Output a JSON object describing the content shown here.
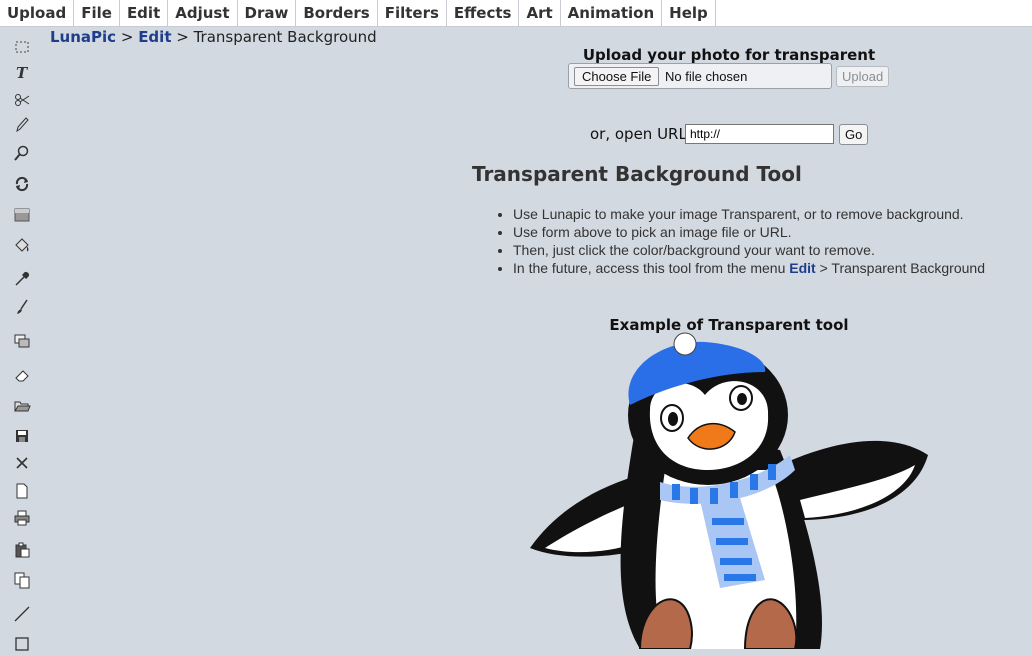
{
  "menu": [
    "Upload",
    "File",
    "Edit",
    "Adjust",
    "Draw",
    "Borders",
    "Filters",
    "Effects",
    "Art",
    "Animation",
    "Help"
  ],
  "toolbar": [
    {
      "name": "select-rectangle-icon"
    },
    {
      "name": "text-tool-icon"
    },
    {
      "name": "scissors-icon"
    },
    {
      "name": "pencil-icon"
    },
    {
      "name": "zoom-icon"
    },
    {
      "name": "rotate-icon"
    },
    {
      "name": "gradient-icon"
    },
    {
      "name": "paint-bucket-icon"
    },
    {
      "name": "eyedropper-icon"
    },
    {
      "name": "brush-icon"
    },
    {
      "name": "layers-icon"
    },
    {
      "name": "eraser-icon"
    },
    {
      "name": "open-folder-icon"
    },
    {
      "name": "save-icon"
    },
    {
      "name": "close-icon"
    },
    {
      "name": "new-page-icon"
    },
    {
      "name": "print-icon"
    },
    {
      "name": "paste-icon"
    },
    {
      "name": "copy-icon"
    },
    {
      "name": "line-tool-icon"
    },
    {
      "name": "rectangle-tool-icon"
    }
  ],
  "breadcrumb": {
    "home": "LunaPic",
    "sep1": " > ",
    "section": "Edit",
    "sep2": " > ",
    "current": "Transparent Background"
  },
  "upload": {
    "title": "Upload your photo for transparent",
    "choose_label": "Choose File",
    "no_file_text": "No file chosen",
    "upload_label": "Upload"
  },
  "url": {
    "label": "or, open URL",
    "value": "http://",
    "go_label": "Go"
  },
  "tool": {
    "title": "Transparent Background Tool",
    "tips": [
      "Use Lunapic to make your image Transparent, or to remove background.",
      "Use form above to pick an image file or URL.",
      "Then, just click the color/background your want to remove."
    ],
    "tip4_prefix": "In the future, access this tool from the menu ",
    "tip4_link": "Edit",
    "tip4_suffix": " > Transparent Background"
  },
  "example": {
    "caption": "Example of Transparent tool",
    "image": "penguin-illustration"
  },
  "colors": {
    "background": "#d3d9e1",
    "link": "#1f3d8a",
    "hat": "#2a6fe8",
    "scarf_light": "#a9c6f5",
    "beak": "#f07a1a",
    "feet": "#b46a4a"
  }
}
